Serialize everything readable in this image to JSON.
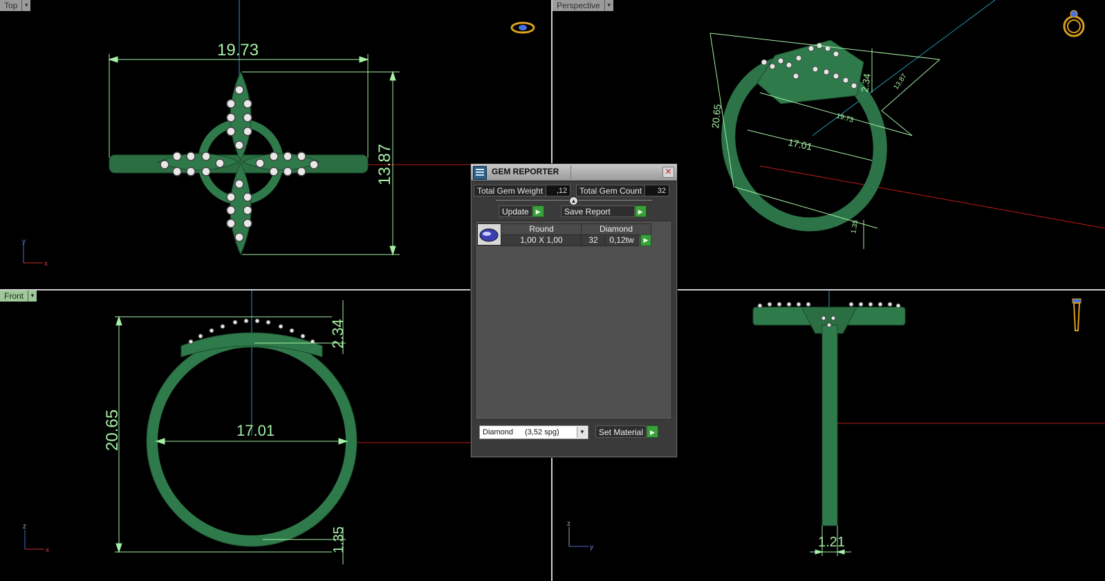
{
  "viewports": {
    "top": {
      "label": "Top",
      "dims": {
        "width": "19.73",
        "height": "13.87"
      },
      "axes": [
        "y",
        "x"
      ]
    },
    "perspective": {
      "label": "Perspective",
      "dims": {
        "height": "20.65",
        "top": "2.34",
        "depth": "13.87",
        "inner": "17.01",
        "side": "19.73",
        "bottom": "1.35"
      }
    },
    "front": {
      "label": "Front",
      "dims": {
        "height": "20.65",
        "top": "2.34",
        "inner": "17.01",
        "bottom": "1.35"
      },
      "axes": [
        "z",
        "x"
      ]
    },
    "right": {
      "dims": {
        "width": "1.21"
      },
      "axes": [
        "z",
        "y"
      ]
    }
  },
  "gem_reporter": {
    "title": "GEM REPORTER",
    "total_weight_label": "Total Gem Weight",
    "total_weight_value": ",12",
    "total_count_label": "Total Gem Count",
    "total_count_value": "32",
    "update_label": "Update",
    "save_report_label": "Save Report",
    "columns": [
      "Round",
      "Diamond"
    ],
    "gems": [
      {
        "size": "1,00 X 1,00",
        "count": "32",
        "weight": "0,12tw"
      }
    ],
    "material_select": {
      "name": "Diamond",
      "spg": "(3,52 spg)"
    },
    "set_material_label": "Set Material"
  },
  "colors": {
    "model": "#2f7a4a",
    "dim_line": "#a6f0a6",
    "axis_red": "#d21f1f",
    "axis_cyan": "#2e9ab8"
  }
}
